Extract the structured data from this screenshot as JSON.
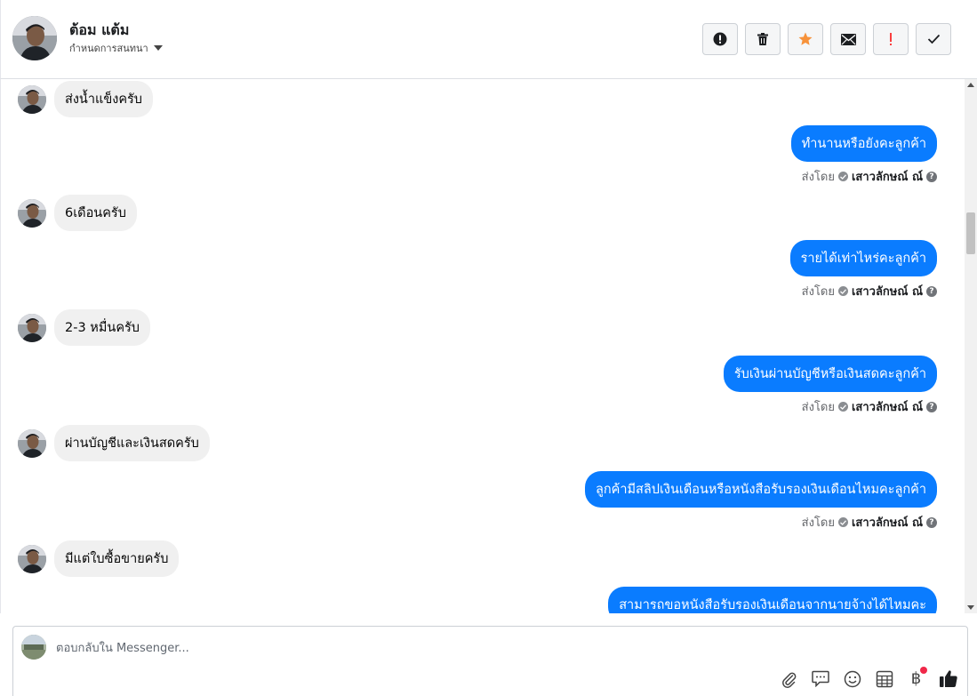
{
  "header": {
    "name": "ต้อม แต้ม",
    "subtitle": "กำหนดการสนทนา"
  },
  "actions": [
    {
      "icon": "alert-circle-icon",
      "name": "mark-spam-button"
    },
    {
      "icon": "trash-icon",
      "name": "delete-button"
    },
    {
      "icon": "star-icon",
      "name": "star-button"
    },
    {
      "icon": "envelope-icon",
      "name": "mark-unread-button"
    },
    {
      "icon": "exclamation-icon",
      "name": "mark-important-button"
    },
    {
      "icon": "checkmark-icon",
      "name": "mark-done-button"
    }
  ],
  "messages": [
    {
      "dir": "in",
      "text": "ส่งน้ำแข็งครับ"
    },
    {
      "dir": "out",
      "text": "ทำนานหรือยังคะลูกค้า",
      "meta_prefix": "ส่งโดย",
      "sender": "เสาวลักษณ์ ณ์"
    },
    {
      "dir": "in",
      "text": "6เดือนครับ"
    },
    {
      "dir": "out",
      "text": "รายได้เท่าไหร่คะลูกค้า",
      "meta_prefix": "ส่งโดย",
      "sender": "เสาวลักษณ์ ณ์"
    },
    {
      "dir": "in",
      "text": "2-3 หมื่นครับ"
    },
    {
      "dir": "out",
      "text": "รับเงินผ่านบัญชีหรือเงินสดคะลูกค้า",
      "meta_prefix": "ส่งโดย",
      "sender": "เสาวลักษณ์ ณ์"
    },
    {
      "dir": "in",
      "text": "ผ่านบัญชีและเงินสดครับ"
    },
    {
      "dir": "out",
      "text": "ลูกค้ามีสลิปเงินเดือนหรือหนังสือรับรองเงินเดือนไหมคะลูกค้า",
      "meta_prefix": "ส่งโดย",
      "sender": "เสาวลักษณ์ ณ์"
    },
    {
      "dir": "in",
      "text": "มีแต่ใบซื้อขายครับ"
    },
    {
      "dir": "out",
      "text": "สามารถขอหนังสือรับรองเงินเดือนจากนายจ้างได้ไหมคะ"
    }
  ],
  "composer": {
    "placeholder": "ตอบกลับใน Messenger...",
    "value": "",
    "currency_symbol": "฿"
  },
  "colors": {
    "outgoing_bubble": "#0a7cff",
    "incoming_bubble": "#f0f0f0",
    "star": "#f7923a",
    "important": "#fa3e3e",
    "notification_dot": "#f02849"
  }
}
